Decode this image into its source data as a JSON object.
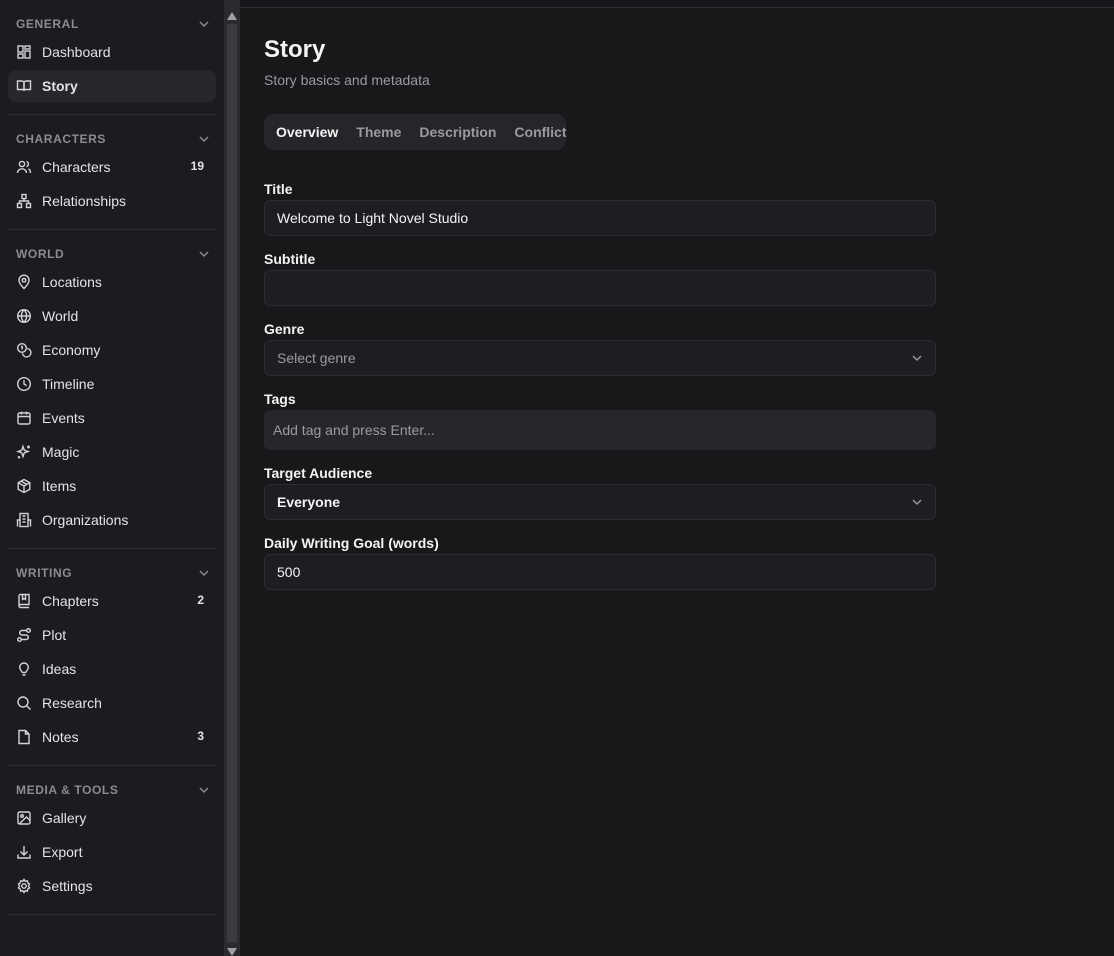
{
  "colors": {
    "background": "#18181b",
    "sidebar": "#1c1c20",
    "active_item": "#27272b",
    "muted_text": "#9a9aa2"
  },
  "sidebar": {
    "sections": [
      {
        "label": "GENERAL",
        "items": [
          {
            "label": "Dashboard",
            "icon": "layout-grid-icon"
          },
          {
            "label": "Story",
            "icon": "book-open-icon",
            "active": true
          }
        ]
      },
      {
        "label": "CHARACTERS",
        "items": [
          {
            "label": "Characters",
            "icon": "users-icon",
            "badge": "19"
          },
          {
            "label": "Relationships",
            "icon": "network-icon"
          }
        ]
      },
      {
        "label": "WORLD",
        "items": [
          {
            "label": "Locations",
            "icon": "map-pin-icon"
          },
          {
            "label": "World",
            "icon": "globe-icon"
          },
          {
            "label": "Economy",
            "icon": "coins-icon"
          },
          {
            "label": "Timeline",
            "icon": "clock-icon"
          },
          {
            "label": "Events",
            "icon": "calendar-icon"
          },
          {
            "label": "Magic",
            "icon": "sparkles-icon"
          },
          {
            "label": "Items",
            "icon": "package-icon"
          },
          {
            "label": "Organizations",
            "icon": "building-icon"
          }
        ]
      },
      {
        "label": "WRITING",
        "items": [
          {
            "label": "Chapters",
            "icon": "book-icon",
            "badge": "2"
          },
          {
            "label": "Plot",
            "icon": "route-icon"
          },
          {
            "label": "Ideas",
            "icon": "lightbulb-icon"
          },
          {
            "label": "Research",
            "icon": "search-icon"
          },
          {
            "label": "Notes",
            "icon": "file-icon",
            "badge": "3"
          }
        ]
      },
      {
        "label": "MEDIA & TOOLS",
        "items": [
          {
            "label": "Gallery",
            "icon": "image-icon"
          },
          {
            "label": "Export",
            "icon": "download-icon"
          },
          {
            "label": "Settings",
            "icon": "gear-icon"
          }
        ]
      }
    ]
  },
  "main": {
    "title": "Story",
    "subtitle": "Story basics and metadata",
    "tabs": [
      "Overview",
      "Theme",
      "Description",
      "Conflict"
    ],
    "active_tab": "Overview",
    "fields": {
      "title": {
        "label": "Title",
        "value": "Welcome to Light Novel Studio"
      },
      "subtitle": {
        "label": "Subtitle",
        "value": ""
      },
      "genre": {
        "label": "Genre",
        "placeholder": "Select genre"
      },
      "tags": {
        "label": "Tags",
        "placeholder": "Add tag and press Enter..."
      },
      "audience": {
        "label": "Target Audience",
        "value": "Everyone"
      },
      "goal": {
        "label": "Daily Writing Goal (words)",
        "value": "500"
      }
    }
  }
}
